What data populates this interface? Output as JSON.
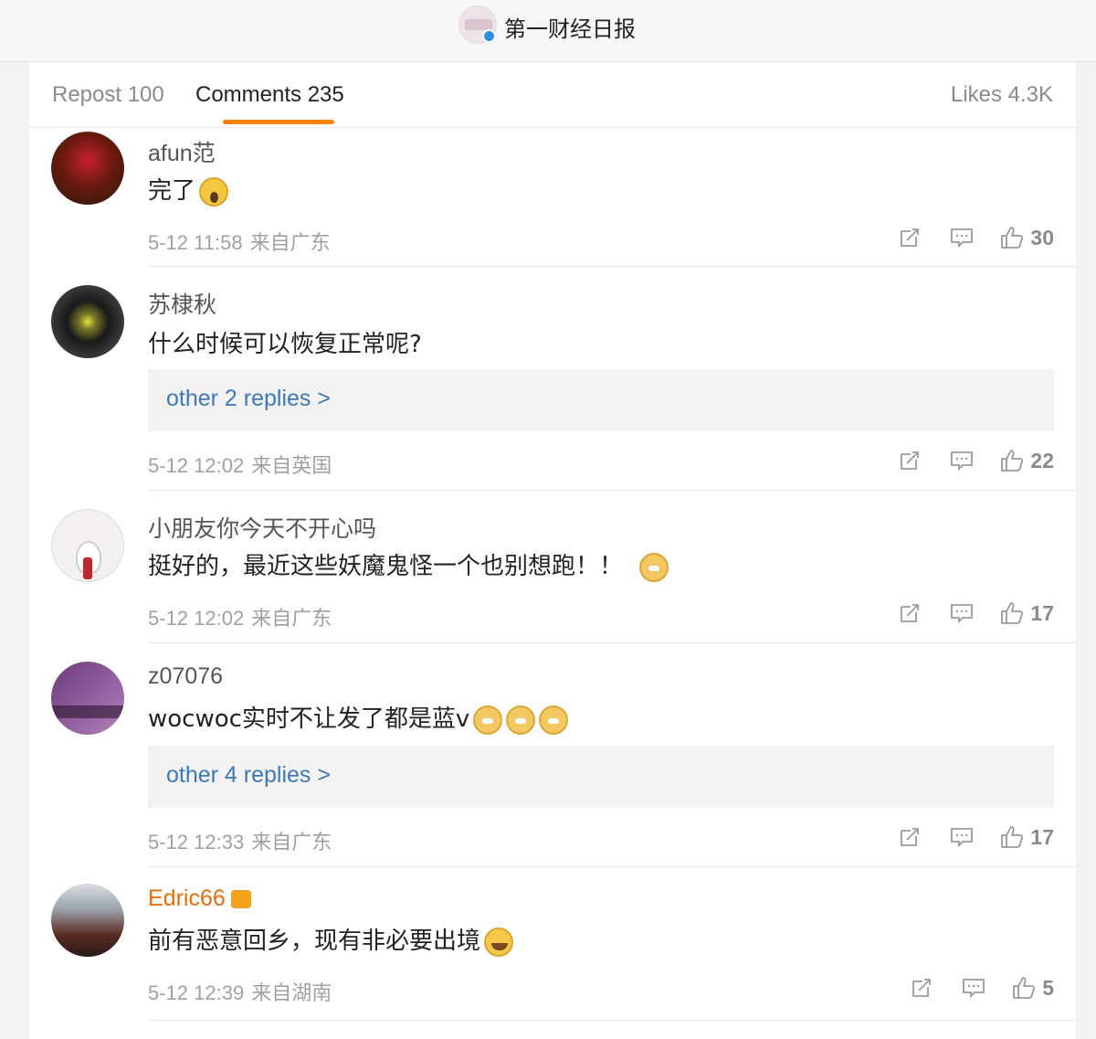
{
  "header": {
    "account_name": "第一财经日报"
  },
  "tabs": {
    "repost": "Repost 100",
    "comments": "Comments 235",
    "likes": "Likes 4.3K"
  },
  "comments": [
    {
      "user": "afun范",
      "text": "完了",
      "emoji": "scream-emoji",
      "time": "5-12 11:58",
      "location": "来自广东",
      "likes": "30",
      "replies": ""
    },
    {
      "user": "苏棣秋",
      "text": "什么时候可以恢复正常呢?",
      "emoji": "",
      "time": "5-12 12:02",
      "location": "来自英国",
      "likes": "22",
      "replies": "other 2 replies >"
    },
    {
      "user": "小朋友你今天不开心吗",
      "text": "挺好的，最近这些妖魔鬼怪一个也别想跑！！",
      "emoji": "doge-emoji",
      "time": "5-12 12:02",
      "location": "来自广东",
      "likes": "17",
      "replies": ""
    },
    {
      "user": "z07076",
      "text": "wocwoc实时不让发了都是蓝v",
      "emoji": "doge-emoji x3",
      "time": "5-12 12:33",
      "location": "来自广东",
      "likes": "17",
      "replies": "other 4 replies >"
    },
    {
      "user": "Edric66",
      "text": "前有恶意回乡，现有非必要出境",
      "emoji": "laugh-cry-emoji",
      "time": "5-12 12:39",
      "location": "来自湖南",
      "likes": "5",
      "replies": ""
    }
  ],
  "colors": {
    "accent": "#ff8200",
    "link": "#3e79b5",
    "vip_name": "#e86b0c"
  },
  "icons": [
    "share-icon",
    "comment-icon",
    "like-icon",
    "verified-icon",
    "crown-icon"
  ]
}
